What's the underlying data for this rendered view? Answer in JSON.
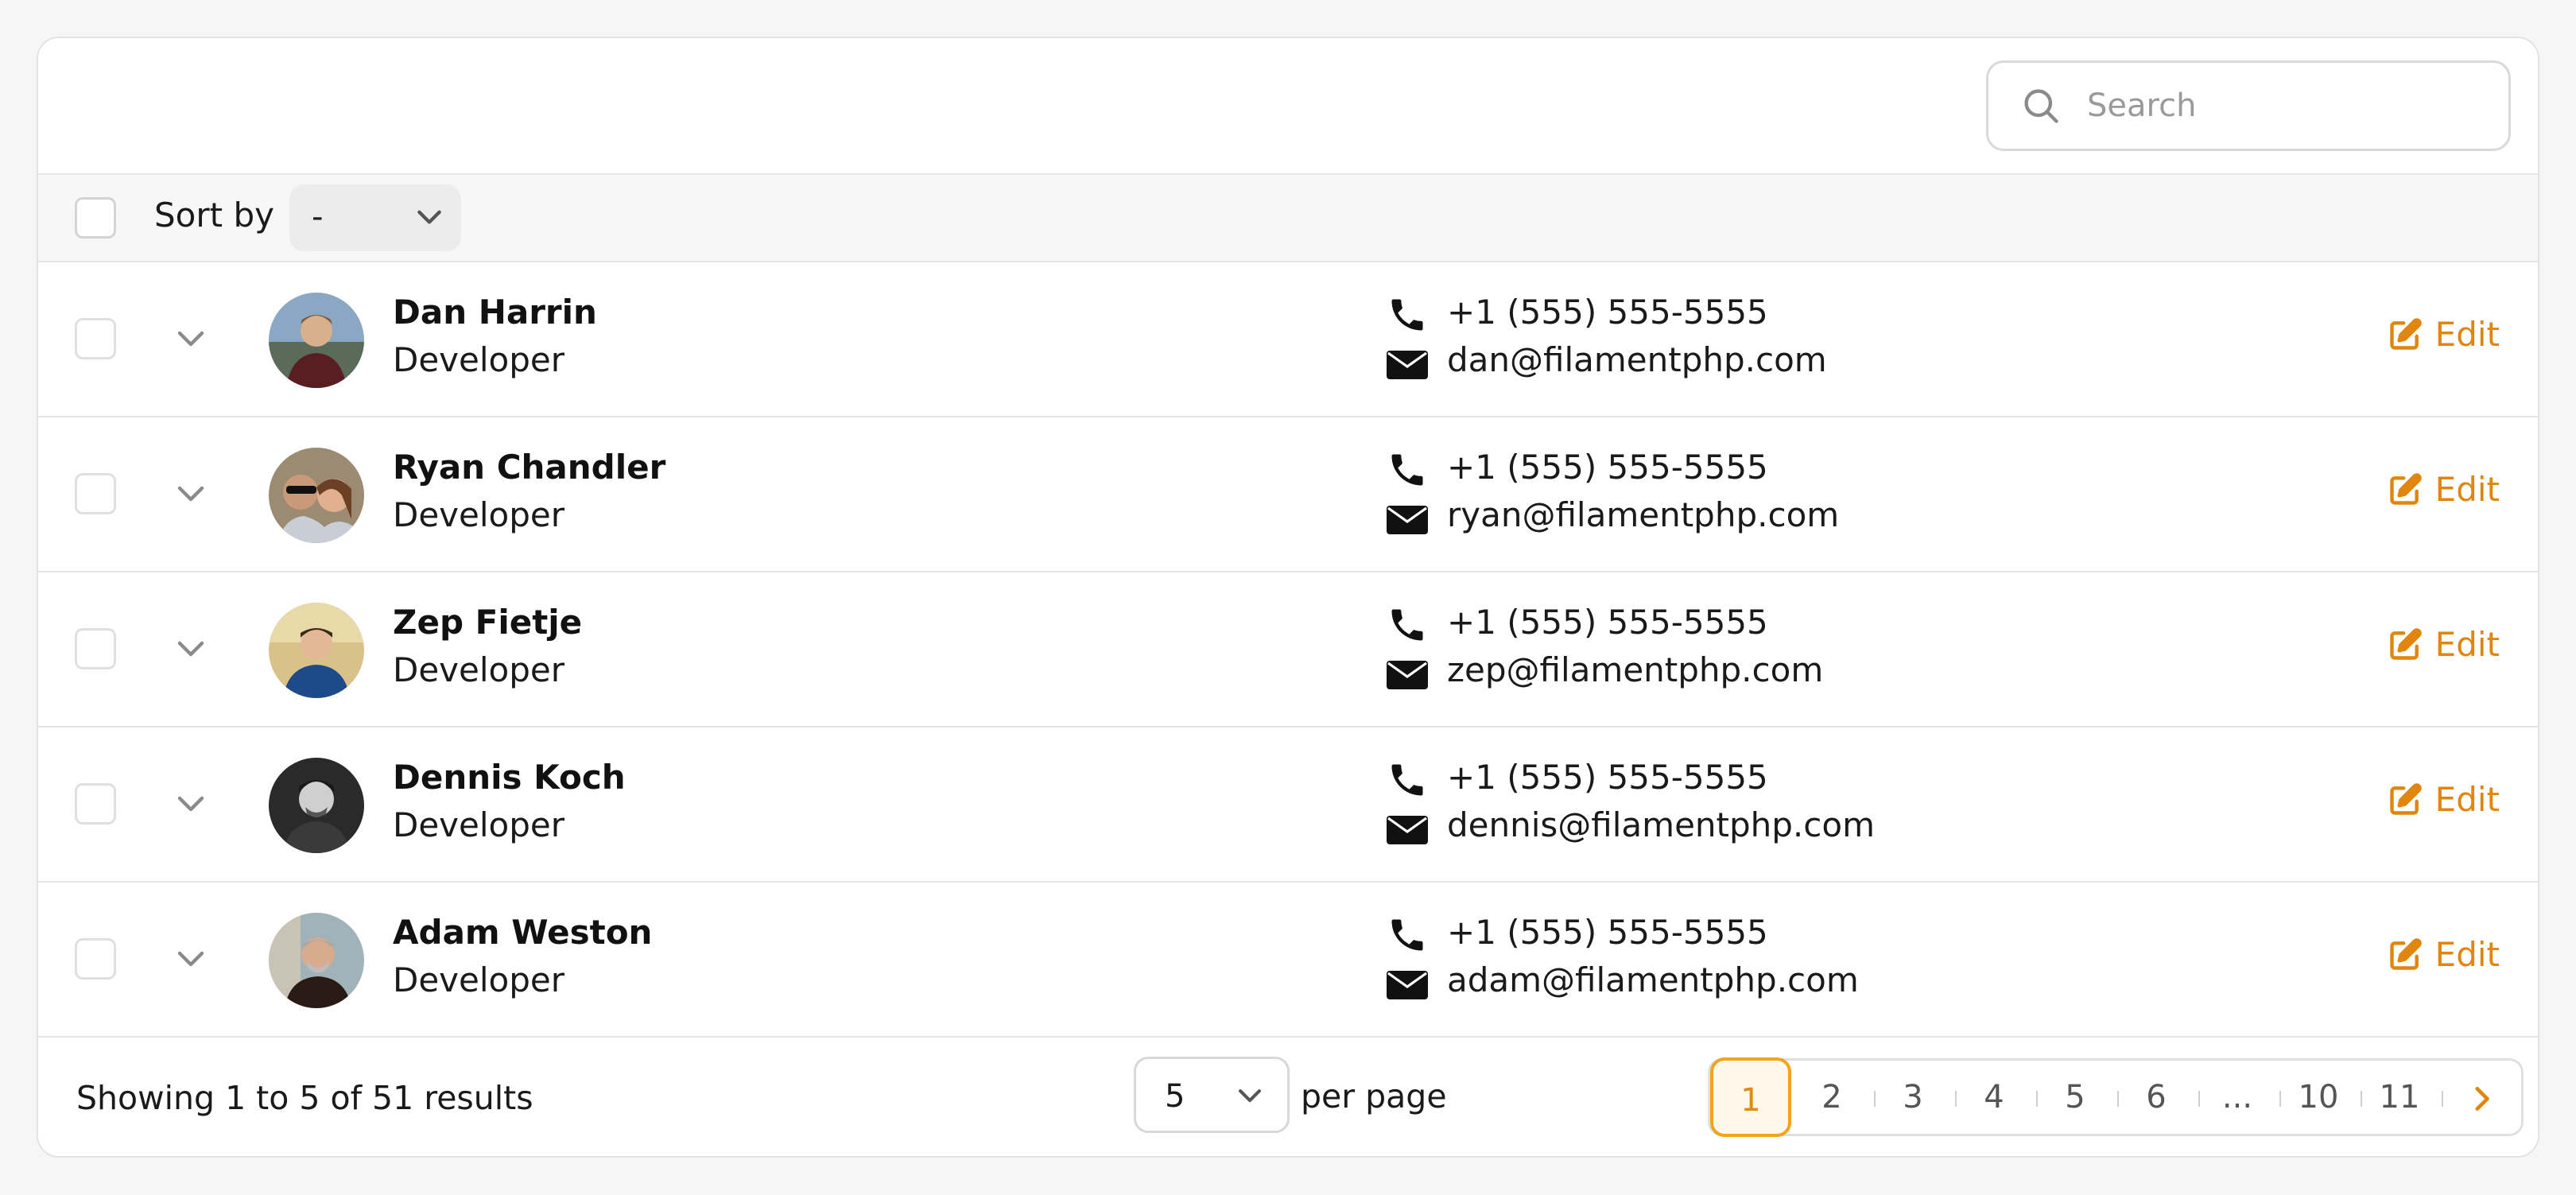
{
  "search": {
    "placeholder": "Search"
  },
  "sort": {
    "label": "Sort by",
    "selected": "-"
  },
  "rows": [
    {
      "name": "Dan Harrin",
      "role": "Developer",
      "phone": "+1 (555) 555-5555",
      "email": "dan@filamentphp.com",
      "action": "Edit"
    },
    {
      "name": "Ryan Chandler",
      "role": "Developer",
      "phone": "+1 (555) 555-5555",
      "email": "ryan@filamentphp.com",
      "action": "Edit"
    },
    {
      "name": "Zep Fietje",
      "role": "Developer",
      "phone": "+1 (555) 555-5555",
      "email": "zep@filamentphp.com",
      "action": "Edit"
    },
    {
      "name": "Dennis Koch",
      "role": "Developer",
      "phone": "+1 (555) 555-5555",
      "email": "dennis@filamentphp.com",
      "action": "Edit"
    },
    {
      "name": "Adam Weston",
      "role": "Developer",
      "phone": "+1 (555) 555-5555",
      "email": "adam@filamentphp.com",
      "action": "Edit"
    }
  ],
  "footer": {
    "showing": "Showing 1 to 5 of 51 results",
    "per_page_value": "5",
    "per_page_label": "per page",
    "pages": [
      "1",
      "2",
      "3",
      "4",
      "5",
      "6",
      "...",
      "10",
      "11"
    ],
    "current_page": "1"
  },
  "colors": {
    "accent": "#e0860e",
    "active_border": "#f0a521",
    "border": "#e3e3e3"
  }
}
